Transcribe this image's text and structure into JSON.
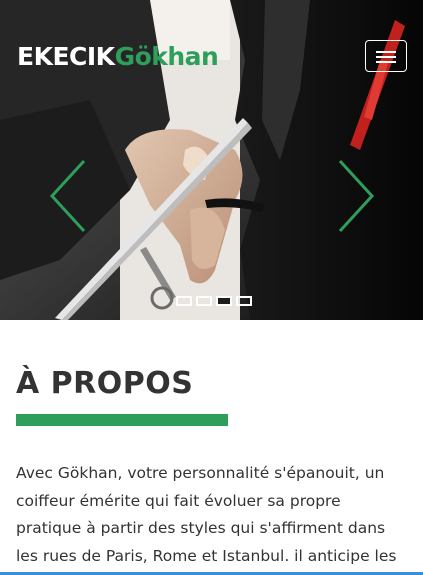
{
  "header": {
    "logo_part_1": "EKECIK",
    "logo_part_2": "Gökhan",
    "menu_icon": "hamburger-menu-icon"
  },
  "hero": {
    "image_subject": "hairdresser cutting hair with comb and scissors",
    "prev_icon": "chevron-left-icon",
    "next_icon": "chevron-right-icon",
    "slide_count": 4,
    "active_slide": 3
  },
  "about": {
    "title": "À PROPOS",
    "paragraph": "Avec Gökhan, votre personnalité s'épanouit, un coiffeur émérite qui fait évoluer sa propre pratique à partir des styles qui s'affirment dans les rues de Paris, Rome et Istanbul. il anticipe les tendances du"
  },
  "colors": {
    "accent": "#2e9e5b",
    "text": "#333333",
    "background": "#ffffff"
  }
}
